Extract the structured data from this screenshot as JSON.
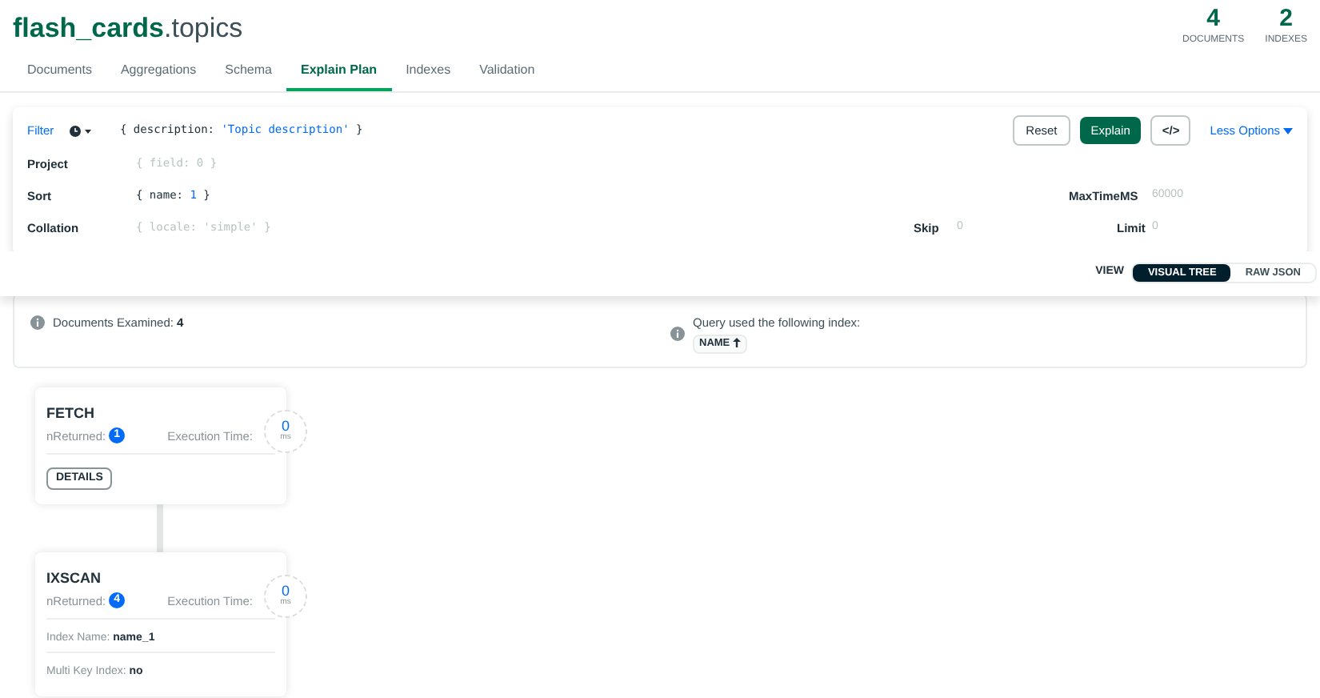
{
  "header": {
    "database": "flash_cards",
    "collection": ".topics",
    "stats": [
      {
        "value": "4",
        "label": "DOCUMENTS"
      },
      {
        "value": "2",
        "label": "INDEXES"
      }
    ]
  },
  "tabs": [
    {
      "label": "Documents",
      "selected": false
    },
    {
      "label": "Aggregations",
      "selected": false
    },
    {
      "label": "Schema",
      "selected": false
    },
    {
      "label": "Explain Plan",
      "selected": true
    },
    {
      "label": "Indexes",
      "selected": false
    },
    {
      "label": "Validation",
      "selected": false
    }
  ],
  "query": {
    "filter_label": "Filter",
    "filter_key": "{ description: ",
    "filter_string": "'Topic description'",
    "filter_end": " }",
    "project_label": "Project",
    "project_placeholder": "{ field: 0 }",
    "sort_label": "Sort",
    "sort_start": "{ name: ",
    "sort_num": "1",
    "sort_end": " }",
    "maxtime_label": "MaxTimeMS",
    "maxtime_placeholder": "60000",
    "collation_label": "Collation",
    "collation_placeholder": "{ locale: 'simple' }",
    "skip_label": "Skip",
    "skip_placeholder": "0",
    "limit_label": "Limit",
    "limit_placeholder": "0",
    "buttons": {
      "reset": "Reset",
      "explain": "Explain",
      "code": "</>",
      "options": "Less Options"
    }
  },
  "view": {
    "label": "VIEW",
    "options": [
      {
        "label": "VISUAL TREE",
        "selected": true
      },
      {
        "label": "RAW JSON",
        "selected": false
      }
    ]
  },
  "summary": {
    "docs_label": "Documents Examined:",
    "docs_value": "4",
    "index_text": "Query used the following index:",
    "index_badge": "NAME"
  },
  "stages": [
    {
      "name": "FETCH",
      "returned_label": "nReturned:",
      "returned": "1",
      "time_label": "Execution Time:",
      "time": "0",
      "unit": "ms",
      "details": "DETAILS"
    },
    {
      "name": "IXSCAN",
      "returned_label": "nReturned:",
      "returned": "4",
      "time_label": "Execution Time:",
      "time": "0",
      "unit": "ms",
      "fields": [
        {
          "label": "Index Name:",
          "value": "name_1"
        },
        {
          "label": "Multi Key Index:",
          "value": "no"
        }
      ]
    }
  ]
}
